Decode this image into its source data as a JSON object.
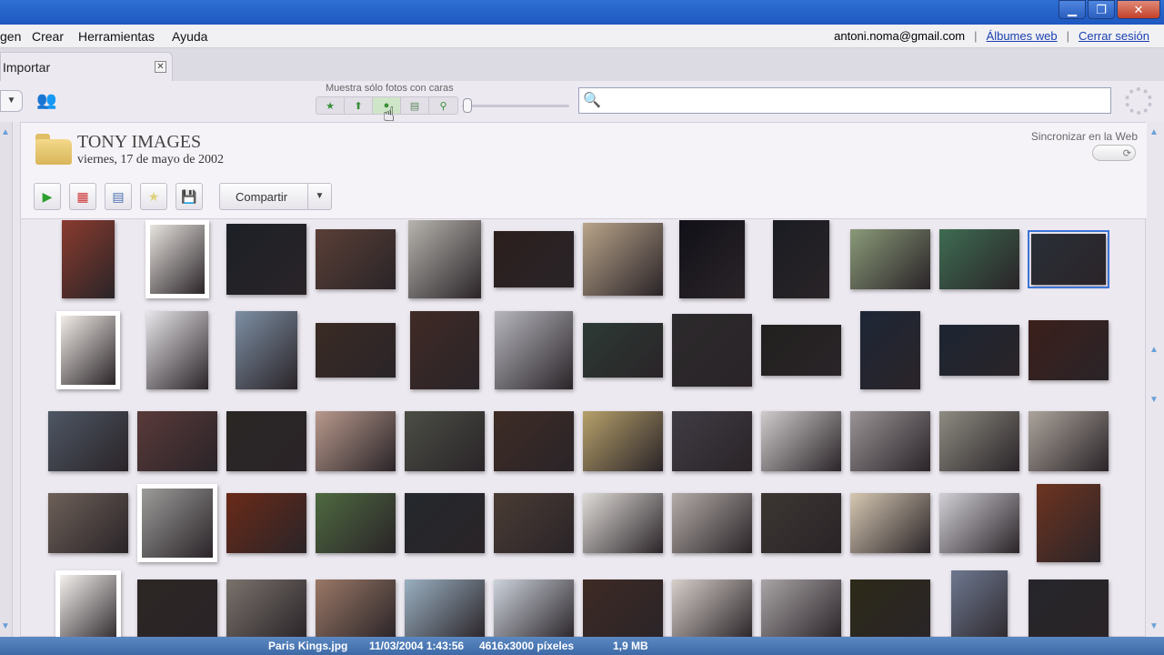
{
  "window": {
    "buttons": [
      "minimize",
      "maximize",
      "close"
    ],
    "title_bar_color": "#2f6fd4"
  },
  "menubar": {
    "items": [
      "gen",
      "Crear",
      "Herramientas",
      "Ayuda"
    ],
    "user_email": "antoni.noma@gmail.com",
    "separator": "|",
    "web_albums_link": "Álbumes web",
    "logout_link": "Cerrar sesión"
  },
  "tab": {
    "label": "Importar",
    "close_symbol": "✕"
  },
  "toolbar": {
    "filter_label": "Muestra sólo fotos con caras",
    "filters": [
      "star",
      "upload",
      "face",
      "film",
      "pin"
    ],
    "active_filter": "face",
    "search_value": "",
    "search_icon": "magnifier-icon"
  },
  "album": {
    "title": "TONY IMAGES",
    "date": "viernes, 17 de mayo de 2002",
    "sync_label": "Sincronizar en la Web",
    "share_label": "Compartir"
  },
  "photo_colors": [
    [
      "#8a3b2e",
      "#e8e4df",
      "#1c2026",
      "#5a3f36",
      "#b7b4ae",
      "#2b1f1d",
      "#b9a48a",
      "#111018",
      "#1a1c22",
      "#8a9a78",
      "#3e6c52",
      "#2a2f38"
    ],
    [
      "#f2ede8",
      "#e8e6ea",
      "#7d8fa4",
      "#3a2b24",
      "#402a26",
      "#b7b7be",
      "#2c3a34",
      "#2c2a2c",
      "#22201f",
      "#1d2636",
      "#1c2532",
      "#3b1f1b"
    ],
    [
      "#4e5764",
      "#5a3a3a",
      "#2a2624",
      "#b8998c",
      "#4b4e45",
      "#3e2c25",
      "#b6a06a",
      "#403c44",
      "#d0cccc",
      "#9a9497",
      "#8e8c82",
      "#aca49c"
    ],
    [
      "#6d6058",
      "#9c9c9a",
      "#6a2a18",
      "#4e6a40",
      "#24282c",
      "#4a3c34",
      "#e0dcd8",
      "#b4aca8",
      "#3c3632",
      "#d6c8b2",
      "#d2d0d6",
      "#6e3420"
    ],
    [
      "#f4f1ee",
      "#2c2624",
      "#7a726c",
      "#9a7866",
      "#9ab0c2",
      "#cdd3dc",
      "#3e2a24",
      "#d7cfca",
      "#a9a4a6",
      "#2c2a18",
      "#6e7890",
      "#26262a"
    ]
  ],
  "status": {
    "filename": "Paris Kings.jpg",
    "datetime": "11/03/2004 1:43:56",
    "dimensions": "4616x3000 píxeles",
    "size": "1,9 MB"
  },
  "accent_color": "#3c74d8"
}
